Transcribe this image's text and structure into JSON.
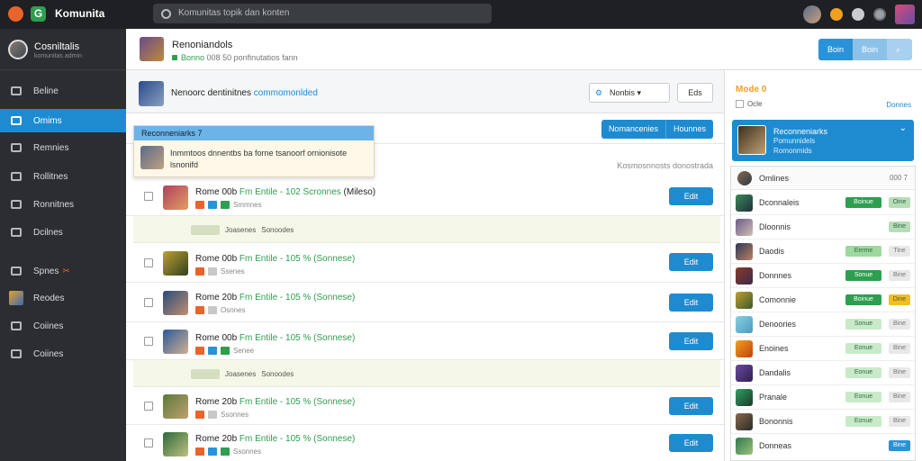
{
  "app": {
    "title": "Komunita"
  },
  "search": {
    "placeholder": "Komunitas topik dan konten"
  },
  "profile": {
    "name": "Cosniltalis",
    "sub": "komunitas admin"
  },
  "sidebar": {
    "items": [
      {
        "label": "Beline"
      },
      {
        "label": "Omims"
      },
      {
        "label": "Remnies"
      },
      {
        "label": "Rollitnes"
      },
      {
        "label": "Ronnitnes"
      },
      {
        "label": "Dcilnes"
      },
      {
        "label": "Spnes"
      },
      {
        "label": "Reodes"
      },
      {
        "label": "Coiines"
      },
      {
        "label": "Coiines"
      }
    ]
  },
  "header": {
    "title": "Renoniandols",
    "status": "Bonno",
    "sub": "008 50 ponfinutatios fann",
    "buttons": [
      "Boin",
      "Boin"
    ]
  },
  "subheader": {
    "text": "Nenoorc dentinitnes",
    "link": "commomonlded",
    "select": "Nonbis",
    "button": "Eds"
  },
  "tabs": {
    "active": "Reconneniarks 7",
    "buttons": [
      "Nomancenies",
      "Hounnes"
    ]
  },
  "sort_text": "Kosmosnnosts donostrada",
  "popup": {
    "head": "Reconneniarks 7",
    "text": "Inmmtoos dnnentbs ba forne tsanoorf ornionisote lsnonifd"
  },
  "rows": [
    {
      "title": "Rome 00b",
      "hl": "Fm Entile - 102 Scronnes",
      "suffix": "(Mileso)",
      "meta": "Smmnes",
      "edit": "Edit"
    },
    {
      "title": "Rome 00b",
      "hl": "Fm Entile - 105 % (Sonnese)",
      "suffix": "",
      "meta": "Ssenes",
      "edit": "Edit"
    },
    {
      "title": "Rome 20b",
      "hl": "Fm Entile - 105 % (Sonnese)",
      "suffix": "",
      "meta": "Osnnes",
      "edit": "Edit"
    },
    {
      "title": "Rome 00b",
      "hl": "Fm Entile - 105 % (Sonnese)",
      "suffix": "",
      "meta": "Senee",
      "edit": "Edit"
    },
    {
      "title": "Rome 20b",
      "hl": "Fm Entile - 105 % (Sonnese)",
      "suffix": "",
      "meta": "Ssonnes",
      "edit": "Edit"
    },
    {
      "title": "Rome 20b",
      "hl": "Fm Entile - 105 % (Sonnese)",
      "suffix": "",
      "meta": "Ssonnes",
      "edit": "Edit"
    }
  ],
  "bars": [
    {
      "a": "Joasenes",
      "b": "Sonoodes"
    },
    {
      "a": "Joasenes",
      "b": "Sonoodes"
    }
  ],
  "right": {
    "head": "Mode 0",
    "sub": "Ocle",
    "link": "Donnes",
    "featured": {
      "title": "Reconneniarks",
      "sub": "Pomunnidels",
      "sub2": "Romonmids"
    },
    "list_title": "Omlines",
    "list_count": "000 7",
    "items": [
      {
        "name": "Dconnaleis",
        "b1": "Boinue",
        "b2": "Oine"
      },
      {
        "name": "Dloonnis",
        "b1": "",
        "b2": "Bine"
      },
      {
        "name": "Daodis",
        "b1": "Eerme",
        "b2": "Tine"
      },
      {
        "name": "Donnnes",
        "b1": "Sonue",
        "b2": "Bine"
      },
      {
        "name": "Comonnie",
        "b1": "Boinue",
        "b2": "Dine"
      },
      {
        "name": "Denoories",
        "b1": "Sonue",
        "b2": "Bine"
      },
      {
        "name": "Enoines",
        "b1": "Eonue",
        "b2": "Bine"
      },
      {
        "name": "Dandalis",
        "b1": "Eonue",
        "b2": "Bine"
      },
      {
        "name": "Pranale",
        "b1": "Eonue",
        "b2": "Bine"
      },
      {
        "name": "Bononnis",
        "b1": "Eonue",
        "b2": "Bine"
      },
      {
        "name": "Donneas",
        "b1": "",
        "b2": "Bine"
      }
    ]
  }
}
